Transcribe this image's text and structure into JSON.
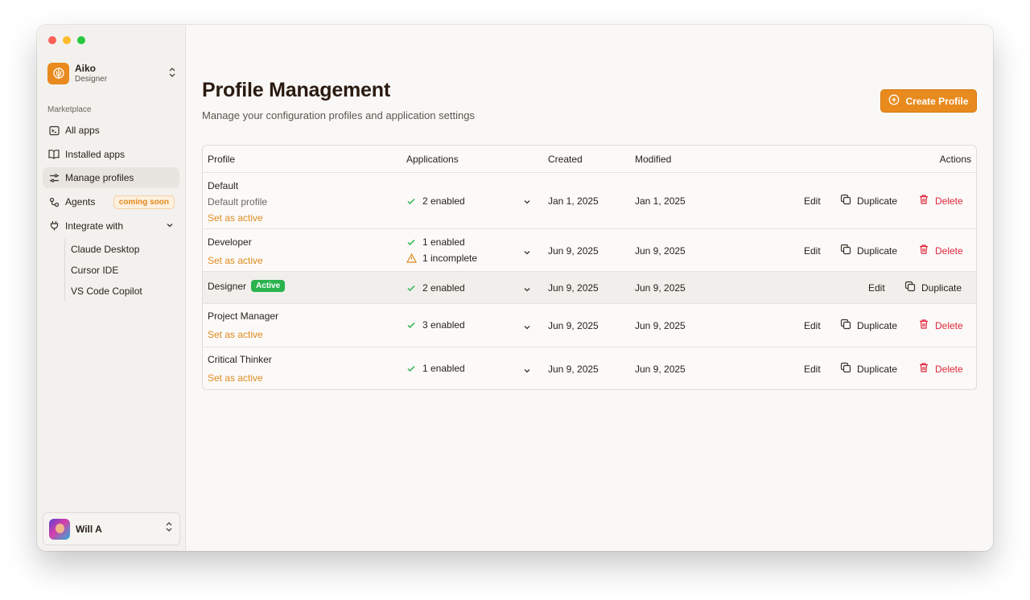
{
  "sidebar": {
    "org": {
      "name": "Aiko",
      "role": "Designer"
    },
    "section_label": "Marketplace",
    "items": [
      {
        "label": "All apps",
        "icon": "terminal-icon"
      },
      {
        "label": "Installed apps",
        "icon": "book-icon"
      },
      {
        "label": "Manage profiles",
        "icon": "sliders-icon",
        "active": true
      },
      {
        "label": "Agents",
        "icon": "agents-icon",
        "badge": "coming soon"
      },
      {
        "label": "Integrate with",
        "icon": "plug-icon"
      }
    ],
    "integrations": [
      "Claude Desktop",
      "Cursor IDE",
      "VS Code Copilot"
    ],
    "user": {
      "name": "Will A"
    }
  },
  "main": {
    "title": "Profile Management",
    "subtitle": "Manage your configuration profiles and application settings",
    "create_button": "Create Profile",
    "table": {
      "headers": {
        "profile": "Profile",
        "applications": "Applications",
        "created": "Created",
        "modified": "Modified",
        "actions": "Actions"
      },
      "rows": [
        {
          "name": "Default",
          "description": "Default profile",
          "set_active": "Set as active",
          "apps_enabled": "2 enabled",
          "created": "Jan 1, 2025",
          "modified": "Jan 1, 2025"
        },
        {
          "name": "Developer",
          "set_active": "Set as active",
          "apps_enabled": "1 enabled",
          "apps_incomplete": "1 incomplete",
          "created": "Jun 9, 2025",
          "modified": "Jun 9, 2025"
        },
        {
          "name": "Designer",
          "badge": "Active",
          "apps_enabled": "2 enabled",
          "created": "Jun 9, 2025",
          "modified": "Jun 9, 2025"
        },
        {
          "name": "Project Manager",
          "set_active": "Set as active",
          "apps_enabled": "3 enabled",
          "created": "Jun 9, 2025",
          "modified": "Jun 9, 2025"
        },
        {
          "name": "Critical Thinker",
          "set_active": "Set as active",
          "apps_enabled": "1 enabled",
          "created": "Jun 9, 2025",
          "modified": "Jun 9, 2025"
        }
      ],
      "actions": {
        "edit": "Edit",
        "duplicate": "Duplicate",
        "delete": "Delete"
      }
    }
  },
  "colors": {
    "accent": "#e88a1e",
    "danger": "#e0263a",
    "success": "#2ab34d",
    "warning": "#e08a1e"
  }
}
